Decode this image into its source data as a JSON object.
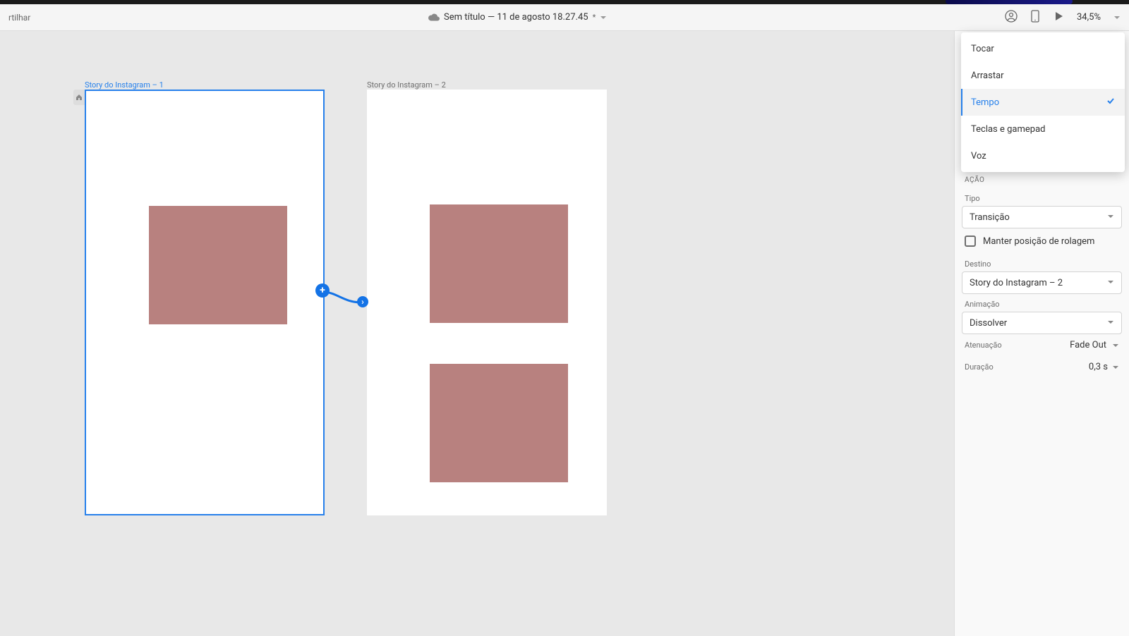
{
  "header": {
    "share_fragment": "rtilhar",
    "doc_title": "Sem título — 11 de agosto 18.27.45",
    "doc_star": "*",
    "zoom": "34,5%"
  },
  "canvas": {
    "artboard1_label": "Story do Instagram – 1",
    "artboard2_label": "Story do Instagram – 2"
  },
  "trigger_menu": {
    "items": [
      "Tocar",
      "Arrastar",
      "Tempo",
      "Teclas e gamepad",
      "Voz"
    ],
    "selected_index": 2
  },
  "panel": {
    "section_title": "AÇÃO",
    "type_label": "Tipo",
    "type_value": "Transição",
    "preserve_scroll_label": "Manter posição de rolagem",
    "destination_label": "Destino",
    "destination_value": "Story do Instagram – 2",
    "animation_label": "Animação",
    "animation_value": "Dissolver",
    "easing_label": "Atenuação",
    "easing_value": "Fade Out",
    "duration_label": "Duração",
    "duration_value": "0,3 s"
  }
}
